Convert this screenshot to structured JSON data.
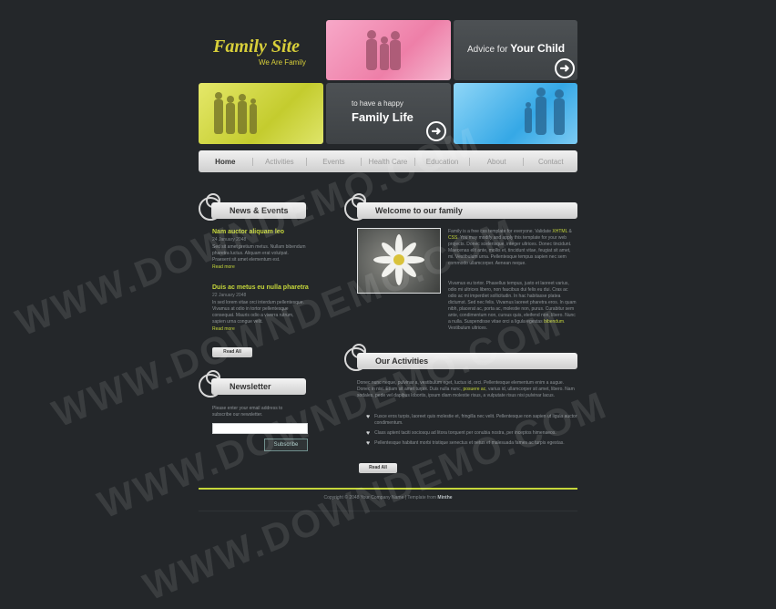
{
  "header": {
    "logo_title": "Family Site",
    "logo_tagline": "We Are Family",
    "tile_advice": {
      "prefix": "Advice for ",
      "highlight": "Your Child"
    },
    "tile_family": {
      "small": "to have a happy",
      "big": "Family Life"
    }
  },
  "nav": {
    "items": [
      {
        "label": "Home",
        "active": true
      },
      {
        "label": "Activities"
      },
      {
        "label": "Events"
      },
      {
        "label": "Health Care"
      },
      {
        "label": "Education"
      },
      {
        "label": "About"
      },
      {
        "label": "Contact"
      }
    ]
  },
  "news": {
    "heading": "News & Events",
    "items": [
      {
        "title": "Nam auctor aliquam leo",
        "date": "24 January 2048",
        "text": "Sed sit amet pretium metus. Nullam bibendum pharetra luctus. Aliquam erat volutpat. Praesent sit amet elementum est.",
        "more": "Read more"
      },
      {
        "title": "Duis ac metus eu nulla pharetra",
        "date": "22 January 2048",
        "text": "In sed lorem vitae orci interdum pellentesque. Vivamus at odio in tortor pellentesque consequat. Mauris odio a viverra rutrum, sapien urna congue velit.",
        "more": "Read more"
      }
    ],
    "read_all": "Read All"
  },
  "newsletter": {
    "heading": "Newsletter",
    "text": "Please enter your email address to subscribe our newsletter.",
    "email_placeholder": "",
    "subscribe": "Subscribe"
  },
  "welcome": {
    "heading": "Welcome to our family",
    "p1_a": "Family is a free css template for everyone. Validate ",
    "p1_link1": "XHTML",
    "p1_mid": " & ",
    "p1_link2": "CSS",
    "p1_b": ". You may modify and apply this template for your web projects. Donec scelerisque, integer ultrices. Donec tincidunt. Maecenas elit ante, mollis et, tincidunt vitae, feugiat sit amet, mi. Vestibulum urna. Pellentesque tempus sapien nec sem commodo ullamcorper. Aenean neque.",
    "p2": "Vivamus eu tortor. Phasellus tempus, justo et laoreet varius, odio mi ultrices libero, non faucibus dui felis eu dui. Cras ac odio ac mi imperdiet sollicitudin. In hac habitasse platea dictumst. Sed nec felis. Vivamus laoreet pharetra eros. In quam nibh, placerat ac, porta ac, molestie non, purus. Curabitur sem ante, condimentum non, cursus quis, eleifend non, libero. Nunc a nulla. Suspendisse vitae orci a ligula egestas ",
    "p2_link": "bibendum",
    "p2_end": ". Vestibulum ultrices."
  },
  "activities": {
    "heading": "Our Activities",
    "text_a": "Donec nunc neque, pulvinar a, vestibulum eget, luctus id, orci. Pellentesque elementum enim a augue. Donec in nisi. Etiam sit amet turpis. Duis nulla nunc, ",
    "text_link": "posuere ac",
    "text_b": ", varius id, ullamcorper sit amet, libero. Nam sodales, pede vel dapibus lobortis, ipsum diam molestie risus, a vulputate risus nisi pulvinar lacus.",
    "bullets": [
      "Fusce eros turpis, laoreet quis molestie et, fringilla nec velit. Pellentesque non sapien ut ligula auctor condimentum.",
      "Class aptent taciti sociosqu ad litora torquent per conubia nostra, per inceptos himenaeos.",
      "Pellentesque habitant morbi tristique senectus et netus et malesuada fames ac turpis egestas."
    ],
    "read_all": "Read All"
  },
  "footer": {
    "copyright": "Copyright © 2048 Your Company Name | Template from ",
    "credit": "Minthe"
  },
  "watermark": "WWW.DOWNDEMO.COM",
  "colors": {
    "background": "#24272a",
    "accent": "#c5d63a",
    "pink_tile": "#ee7fa8",
    "green_tile": "#c4cc2e",
    "blue_tile": "#35a8e6"
  }
}
